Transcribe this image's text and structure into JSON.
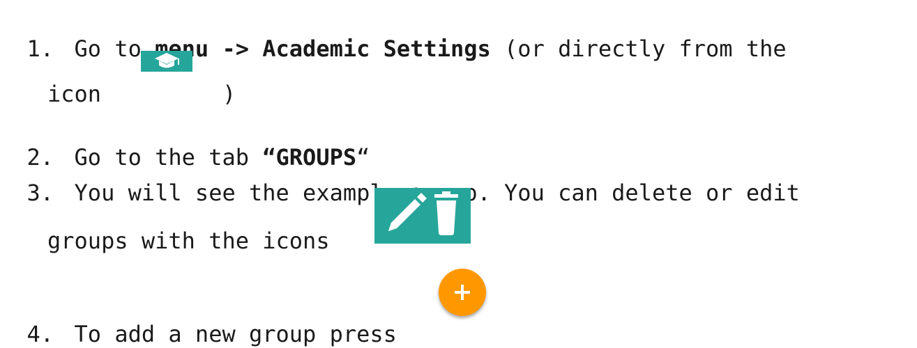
{
  "steps": [
    {
      "number": "1.",
      "prefix": "Go to ",
      "bold": "menu -> Academic Settings",
      "suffix": " (or directly from the",
      "continuation_before": "icon ",
      "continuation_after": ")"
    },
    {
      "number": "2.",
      "prefix": "Go to the tab ",
      "open_quote": "“",
      "bold": "GROUPS",
      "close_quote": "“"
    },
    {
      "number": "3.",
      "text": "You will see the example group. You can delete or edit",
      "continuation": "groups with the icons"
    },
    {
      "number": "4.",
      "text": "To add a new group press"
    }
  ],
  "icons": {
    "academic": "graduation-cap-icon",
    "edit": "pencil-icon",
    "delete": "trash-icon",
    "add": "plus-icon"
  },
  "colors": {
    "teal": "#26a69a",
    "orange": "#ff9800"
  }
}
